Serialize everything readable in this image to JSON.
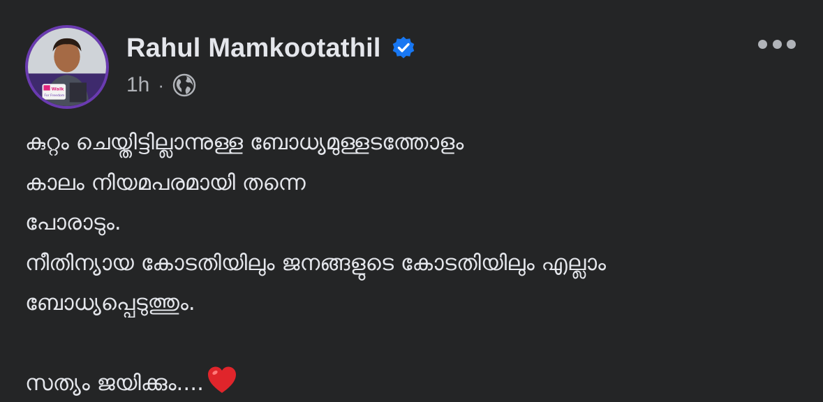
{
  "author": {
    "name": "Rahul Mamkootathil",
    "verified_icon": "verified-badge-icon",
    "avatar_badge_text_1": "Walk",
    "avatar_badge_text_2": "For Freedom"
  },
  "meta": {
    "timestamp": "1h",
    "separator": "·",
    "audience_icon": "globe-icon"
  },
  "menu": {
    "icon": "more-options-icon"
  },
  "post": {
    "lines": [
      "കുറ്റം ചെയ്തിട്ടില്ലാന്നുള്ള ബോധ്യമുള്ളടത്തോളം",
      "കാലം നിയമപരമായി തന്നെ",
      "പോരാടും.",
      "നീതിന്യായ കോടതിയിലും ജനങ്ങളുടെ കോടതിയിലും എല്ലാം",
      "ബോധ്യപ്പെടുത്തും.",
      "",
      "സത്യം ജയിക്കും...."
    ],
    "emoji": "heart-icon"
  },
  "colors": {
    "background": "#242526",
    "primary_text": "#e4e6eb",
    "secondary_text": "#b0b3b8",
    "verified_blue": "#1877f2",
    "heart_red": "#e0252b"
  }
}
